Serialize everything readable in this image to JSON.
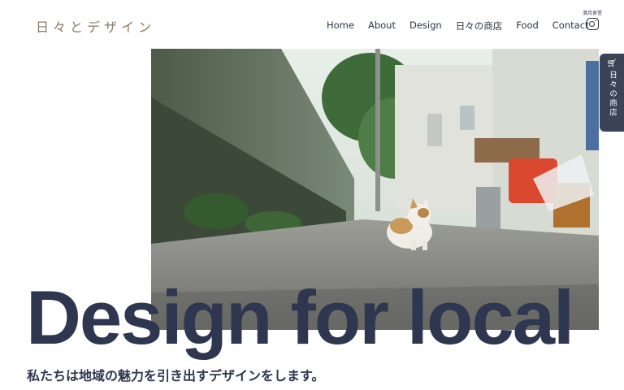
{
  "header": {
    "logo": "日々とデザイン",
    "nav": [
      "Home",
      "About",
      "Design",
      "日々の商店",
      "Food",
      "Contact"
    ],
    "instagram_label": "満月食堂"
  },
  "shop_tab": {
    "label": "日々の商店"
  },
  "hero": {
    "headline": "Design for local",
    "tagline": "私たちは地域の魅力を引き出すデザインをします。"
  },
  "colors": {
    "primary": "#2e3650",
    "logo": "#8a7a66",
    "shop_tab_bg": "#3b4356"
  },
  "icons": [
    "instagram-icon",
    "cart-icon"
  ]
}
